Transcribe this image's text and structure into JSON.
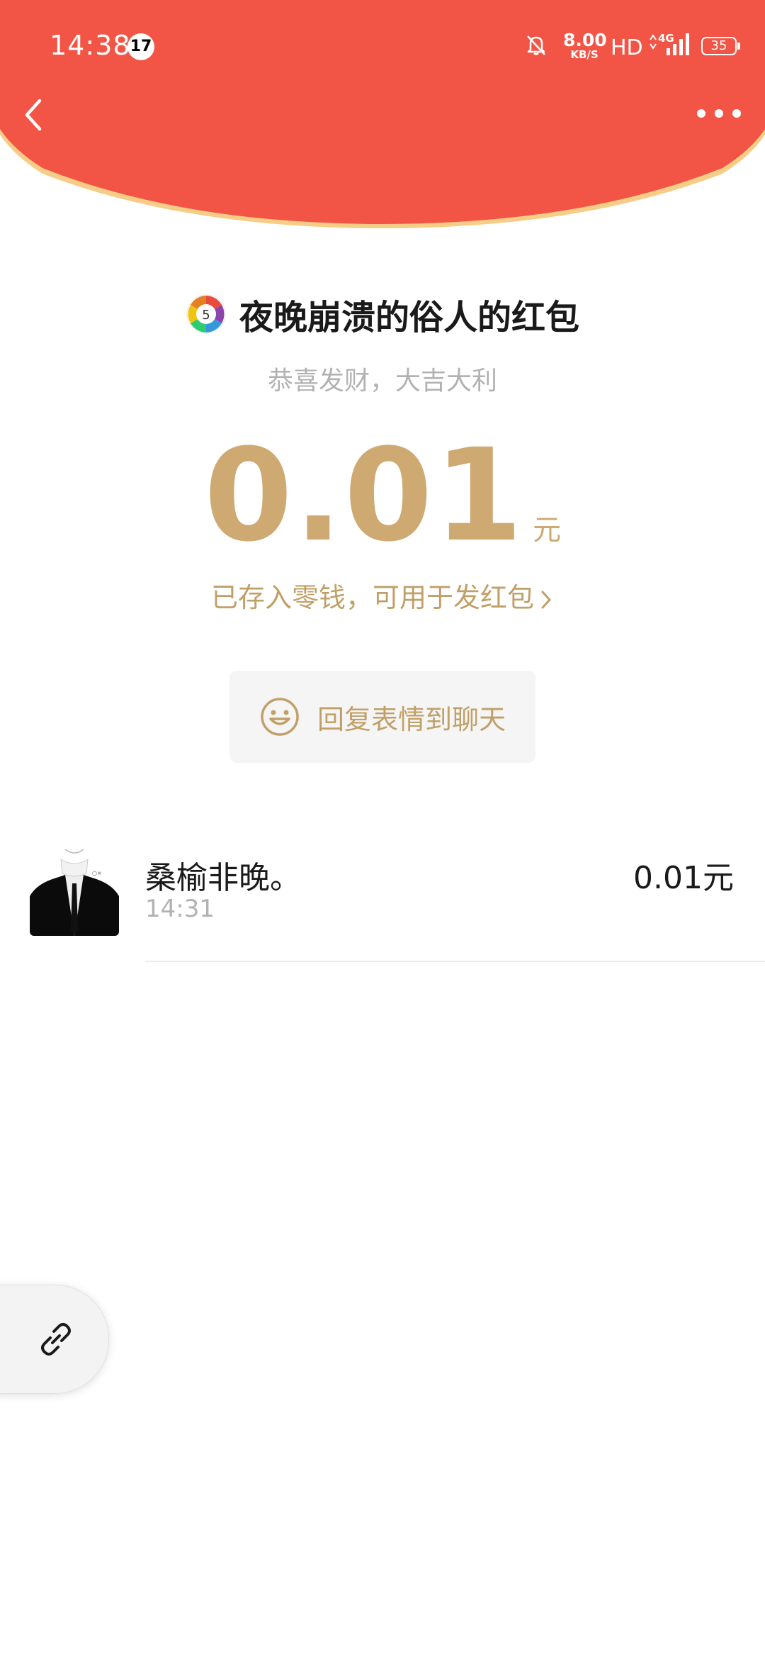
{
  "status_bar": {
    "time": "14:38",
    "notification_count": "17",
    "net_speed_value": "8.00",
    "net_speed_unit": "KB/S",
    "hd_label": "HD",
    "network_type": "4G",
    "battery_level": "35"
  },
  "header": {
    "back_icon": "chevron-left-icon",
    "more_icon": "more-dots-icon",
    "color": "#f25545",
    "rim_color": "#f6cd86"
  },
  "packet": {
    "sender_title": "夜晚崩溃的俗人的红包",
    "blessing": "恭喜发财，大吉大利",
    "amount": "0.01",
    "unit": "元",
    "deposit_note": "已存入零钱，可用于发红包",
    "reply_label": "回复表情到聊天",
    "accent_color": "#cfa972"
  },
  "receivers": [
    {
      "name": "桑榆非晚。",
      "time": "14:31",
      "amount": "0.01元"
    }
  ],
  "floating_button": {
    "icon": "link-icon"
  }
}
